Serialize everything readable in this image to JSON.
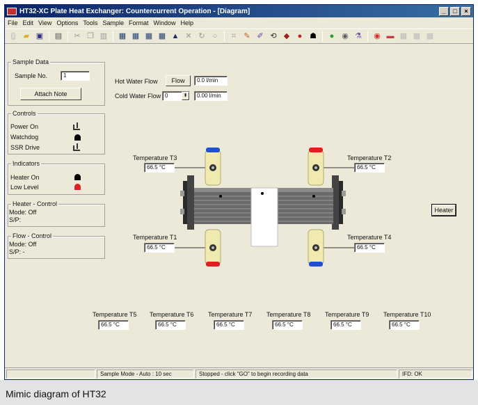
{
  "window": {
    "title": "HT32-XC Plate Heat Exchanger: Countercurrent Operation - [Diagram]",
    "controls": [
      "_",
      "□",
      "×"
    ]
  },
  "menu": [
    "File",
    "Edit",
    "View",
    "Options",
    "Tools",
    "Sample",
    "Format",
    "Window",
    "Help"
  ],
  "toolbar_icons": [
    "new-file-icon",
    "open-folder-icon",
    "save-icon",
    "print-icon",
    "cut-icon",
    "copy-icon",
    "paste-icon",
    "diagram-icon",
    "table-icon",
    "graph-icon",
    "chart-icon",
    "export-icon",
    "delete-icon",
    "refresh-icon",
    "stop-icon",
    "calculator-icon",
    "paint-icon",
    "link-icon",
    "record-icon",
    "bell-icon",
    "go-icon",
    "settings-icon",
    "tool-icon",
    "stop-red-icon",
    "grid-icon",
    "window-icon",
    "help-icon"
  ],
  "sample_data": {
    "legend": "Sample Data",
    "sample_no_label": "Sample No.",
    "sample_no_value": "1",
    "attach_note_label": "Attach Note"
  },
  "controls": {
    "legend": "Controls",
    "items": [
      {
        "label": "Power On",
        "icon": "switch-icon"
      },
      {
        "label": "Watchdog",
        "icon": "bell-icon"
      },
      {
        "label": "SSR Drive",
        "icon": "switch-icon"
      }
    ]
  },
  "indicators": {
    "legend": "Indicators",
    "items": [
      {
        "label": "Heater On",
        "color": "#000000"
      },
      {
        "label": "Low Level",
        "color": "#e02020"
      }
    ]
  },
  "heater_control": {
    "legend": "Heater - Control",
    "mode": "Mode: Off",
    "sp": "S/P:"
  },
  "flow_control": {
    "legend": "Flow - Control",
    "mode": "Mode: Off",
    "sp": "S/P:   -"
  },
  "flows": {
    "hot_label": "Hot Water Flow",
    "hot_button": "Flow",
    "hot_value": "0.0 l/min",
    "cold_label": "Cold Water Flow",
    "cold_setting": "0",
    "cold_value": "0.00 l/min"
  },
  "diagram_temps": {
    "t3": {
      "label": "Temperature T3",
      "value": "66.5 °C"
    },
    "t2": {
      "label": "Temperature T2",
      "value": "66.5 °C"
    },
    "t1": {
      "label": "Temperature T1",
      "value": "66.5 °C"
    },
    "t4": {
      "label": "Temperature T4",
      "value": "66.5 °C"
    }
  },
  "heater_button": "Heater",
  "bottom_temps": [
    {
      "label": "Temperature T5",
      "value": "66.5 °C"
    },
    {
      "label": "Temperature T6",
      "value": "66.5 °C"
    },
    {
      "label": "Temperature T7",
      "value": "66.5 °C"
    },
    {
      "label": "Temperature T8",
      "value": "66.5 °C"
    },
    {
      "label": "Temperature T9",
      "value": "66.5 °C"
    },
    {
      "label": "Temperature T10",
      "value": "66.5 °C"
    }
  ],
  "status": {
    "mode": "Sample Mode - Auto : 10 sec",
    "message": "Stopped - click \"GO\" to begin recording data",
    "ifd": "IFD: OK"
  },
  "caption": "Mimic diagram of HT32",
  "colors": {
    "hot_cap": "#e02020",
    "cold_cap": "#2050d0",
    "valve_body": "#f0eab0",
    "plates": "#6a6a6a"
  }
}
